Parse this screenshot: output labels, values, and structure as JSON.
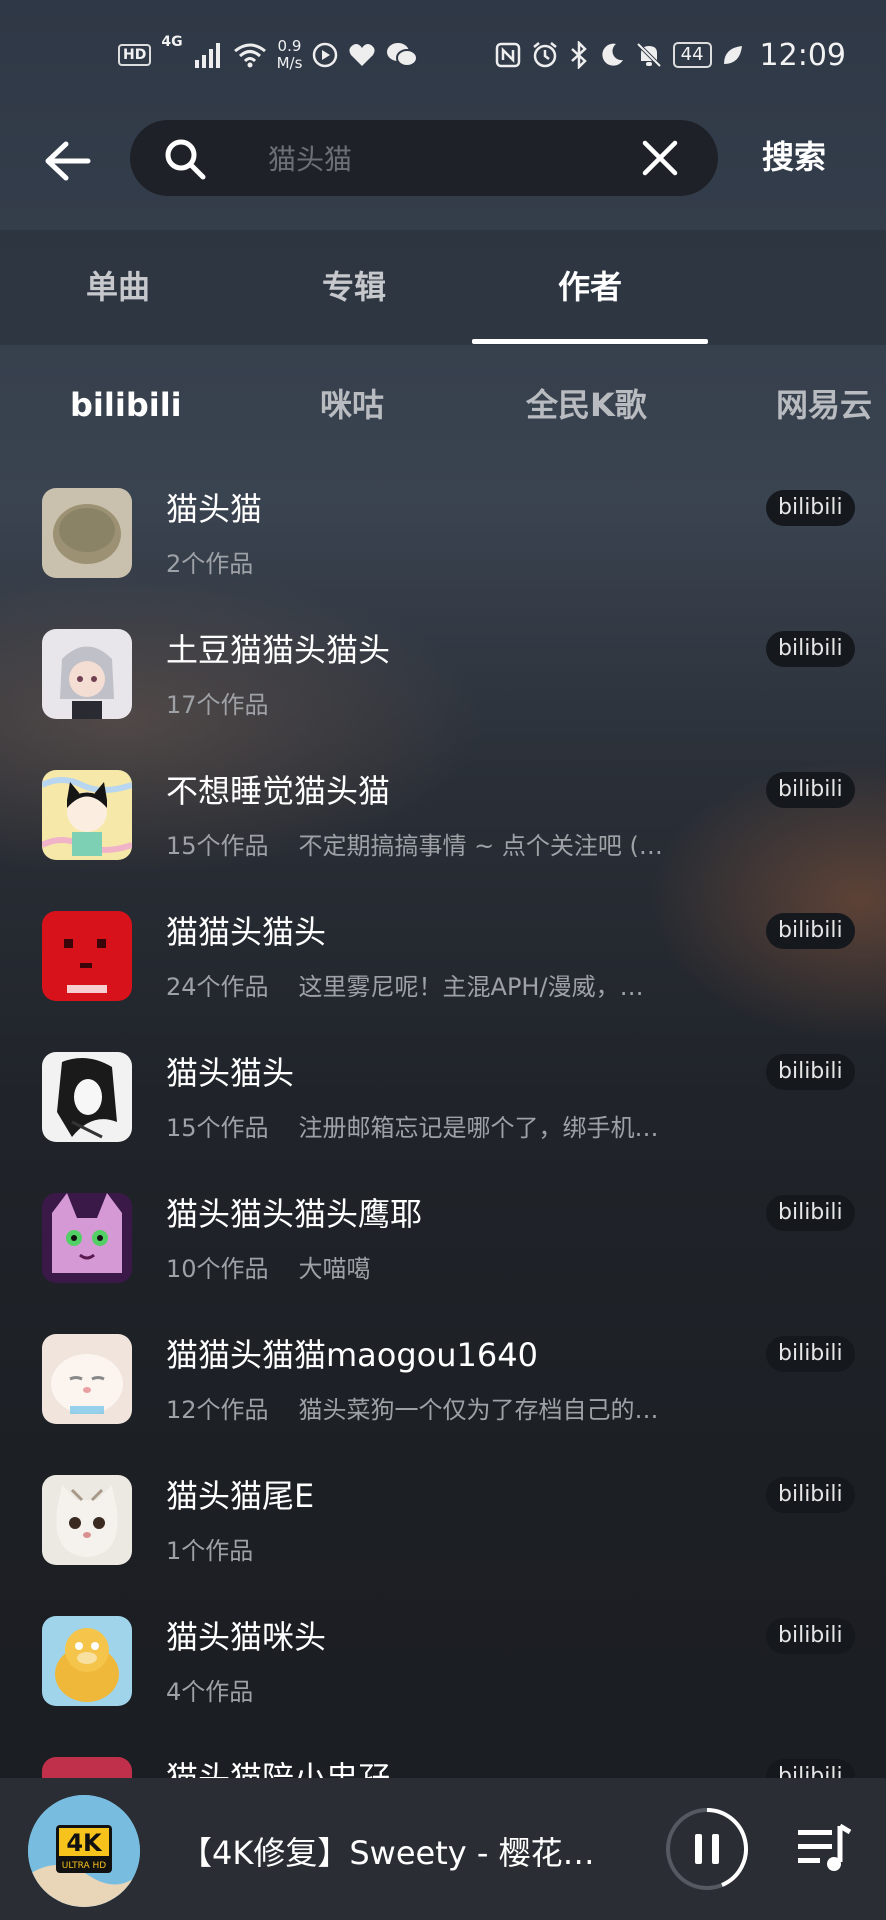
{
  "status_bar": {
    "hd": "HD",
    "network": "4G",
    "speed_value": "0.9",
    "speed_unit": "M/s",
    "battery": "44",
    "time": "12:09",
    "left_icons": [
      "signal-icon",
      "wifi-icon",
      "play-icon",
      "heart-icon",
      "wechat-icon"
    ],
    "right_icons": [
      "nfc-icon",
      "alarm-icon",
      "bluetooth-icon",
      "moon-icon",
      "mute-icon",
      "leaf-icon"
    ]
  },
  "search": {
    "query": "猫头猫",
    "submit_label": "搜索"
  },
  "tabs": [
    {
      "label": "单曲",
      "active": false
    },
    {
      "label": "专辑",
      "active": false
    },
    {
      "label": "作者",
      "active": true
    }
  ],
  "sources": [
    {
      "label": "bilibili",
      "active": true
    },
    {
      "label": "咪咕",
      "active": false
    },
    {
      "label": "全民K歌",
      "active": false
    },
    {
      "label": "网易云",
      "active": false
    }
  ],
  "artists": [
    {
      "name": "猫头猫",
      "works": "2个作品",
      "desc": "",
      "badge": "bilibili"
    },
    {
      "name": "土豆猫猫头猫头",
      "works": "17个作品",
      "desc": "",
      "badge": "bilibili"
    },
    {
      "name": "不想睡觉猫头猫",
      "works": "15个作品",
      "desc": "不定期搞搞事情 ~ 点个关注吧 (…",
      "badge": "bilibili"
    },
    {
      "name": "猫猫头猫头",
      "works": "24个作品",
      "desc": "这里雾尼呢！主混APH/漫威，…",
      "badge": "bilibili"
    },
    {
      "name": "猫头猫头",
      "works": "15个作品",
      "desc": "注册邮箱忘记是哪个了，绑手机…",
      "badge": "bilibili"
    },
    {
      "name": "猫头猫头猫头鹰耶",
      "works": "10个作品",
      "desc": "大喵噶",
      "badge": "bilibili"
    },
    {
      "name": "猫猫头猫猫maogou1640",
      "works": "12个作品",
      "desc": "猫头菜狗一个仅为了存档自己的…",
      "badge": "bilibili"
    },
    {
      "name": "猫头猫尾E",
      "works": "1个作品",
      "desc": "",
      "badge": "bilibili"
    },
    {
      "name": "猫头猫咪头",
      "works": "4个作品",
      "desc": "",
      "badge": "bilibili"
    },
    {
      "name": "猫头猫陪小忠孖",
      "works": "",
      "desc": "",
      "badge": "bilibili"
    }
  ],
  "player": {
    "title": "【4K修复】Sweety - 樱花…",
    "cover_text_1": "4K",
    "cover_text_2": "ULTRA HD"
  }
}
